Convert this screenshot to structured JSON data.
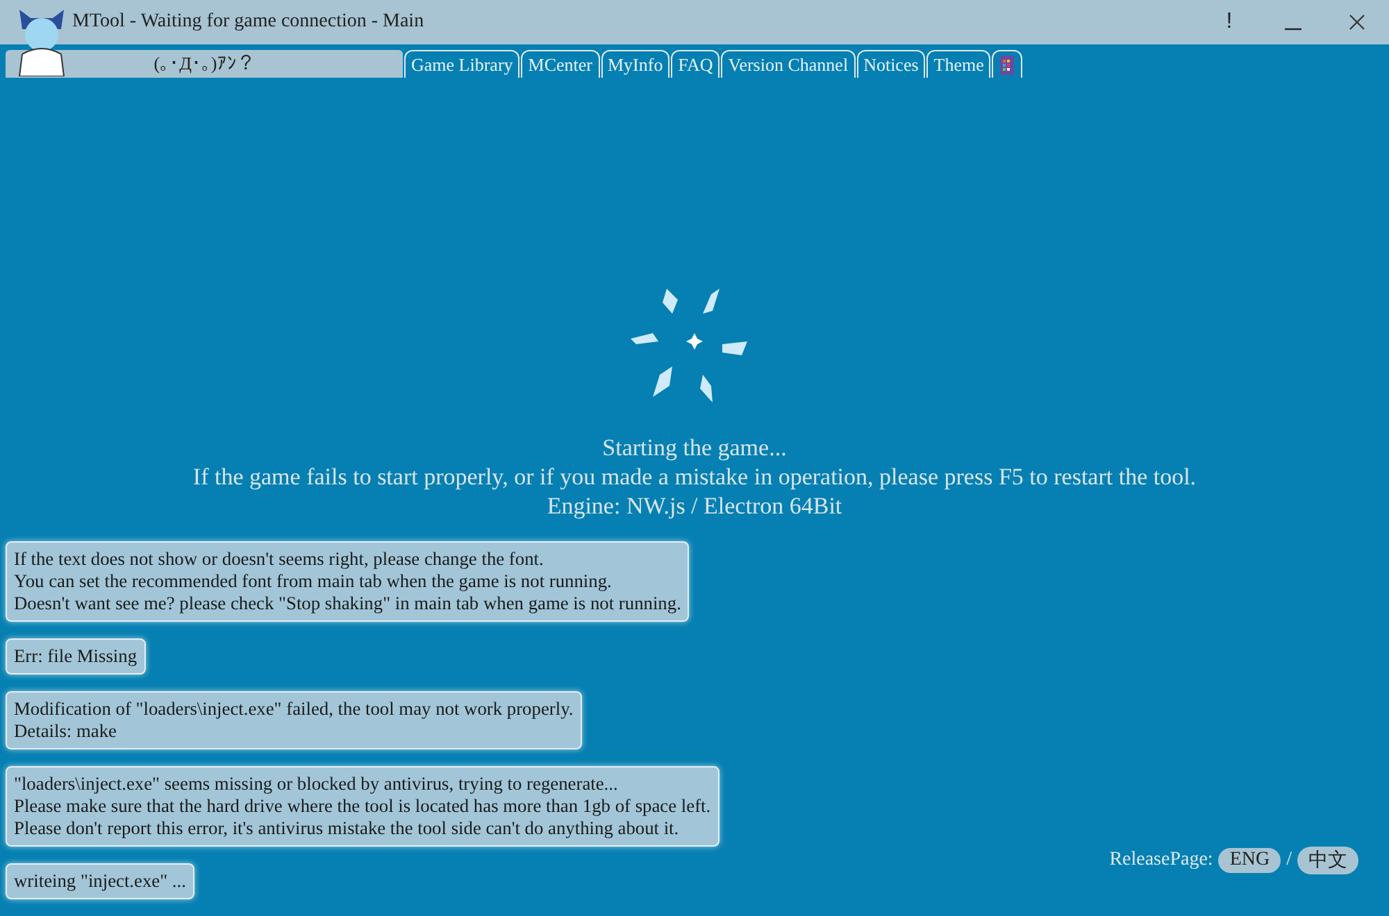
{
  "window": {
    "title": "MTool - Waiting for game connection - Main",
    "controls": [
      {
        "kind": "notice",
        "label": "!"
      },
      {
        "kind": "minimize"
      },
      {
        "kind": "close"
      }
    ]
  },
  "status_field": {
    "value": "(｡･Д･｡)ｱﾝ？"
  },
  "tabs": [
    {
      "label": "Game Library",
      "kind": "text"
    },
    {
      "label": "MCenter",
      "kind": "text"
    },
    {
      "label": "MyInfo",
      "kind": "text"
    },
    {
      "label": "FAQ",
      "kind": "text"
    },
    {
      "label": "Version Channel",
      "kind": "text"
    },
    {
      "label": "Notices",
      "kind": "text"
    },
    {
      "label": "Theme",
      "kind": "text"
    },
    {
      "kind": "icon"
    }
  ],
  "status_lines": [
    "Starting the game...",
    "If the game fails to start properly, or if you made a mistake in operation, please press F5 to restart the tool.",
    "Engine: NW.js / Electron 64Bit"
  ],
  "messages": [
    {
      "lines": [
        "If the text does not show or doesn't seems right, please change the font.",
        "You can set the recommended font from main tab when the game is not running.",
        "Doesn't want see me? please check \"Stop shaking\" in main tab when game is not running."
      ]
    },
    {
      "lines": [
        "Err: file Missing"
      ]
    },
    {
      "lines": [
        "Modification of \"loaders\\inject.exe\" failed, the tool may not work properly.",
        "Details: make"
      ]
    },
    {
      "lines": [
        "\"loaders\\inject.exe\" seems missing or blocked by antivirus, trying to regenerate...",
        "Please make sure that the hard drive where the tool is located has more than 1gb of space left.",
        "Please don't report this error, it's antivirus mistake the tool side can't do anything about it."
      ]
    },
    {
      "lines": [
        "writeing \"inject.exe\" ..."
      ]
    }
  ],
  "release_page": {
    "label": "ReleasePage:",
    "separator": "/",
    "links": [
      "ENG",
      "中文"
    ]
  }
}
